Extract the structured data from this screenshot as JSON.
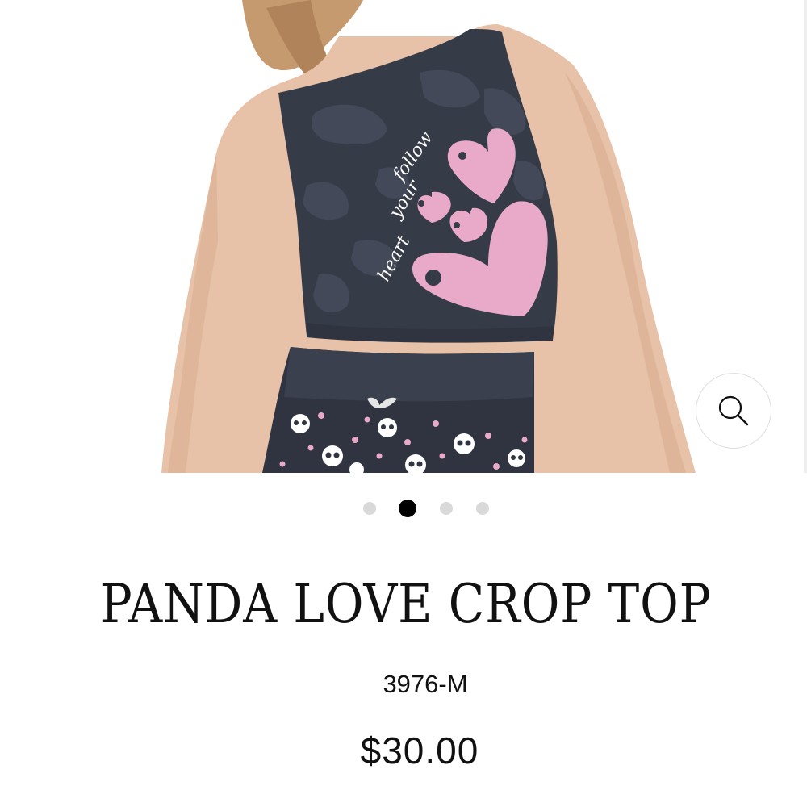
{
  "product": {
    "title": "PANDA LOVE CROP TOP",
    "sku": "3976-M",
    "price": "$30.00",
    "print_text": [
      "follow",
      "your",
      "heart"
    ]
  },
  "gallery": {
    "image_count": 4,
    "active_index": 2,
    "zoom_icon": "magnifier-icon"
  },
  "colors": {
    "fabric": "#363b48",
    "heart_pink": "#e9a9c8",
    "dot_active": "#000000",
    "dot_inactive": "#d9d9d9"
  }
}
